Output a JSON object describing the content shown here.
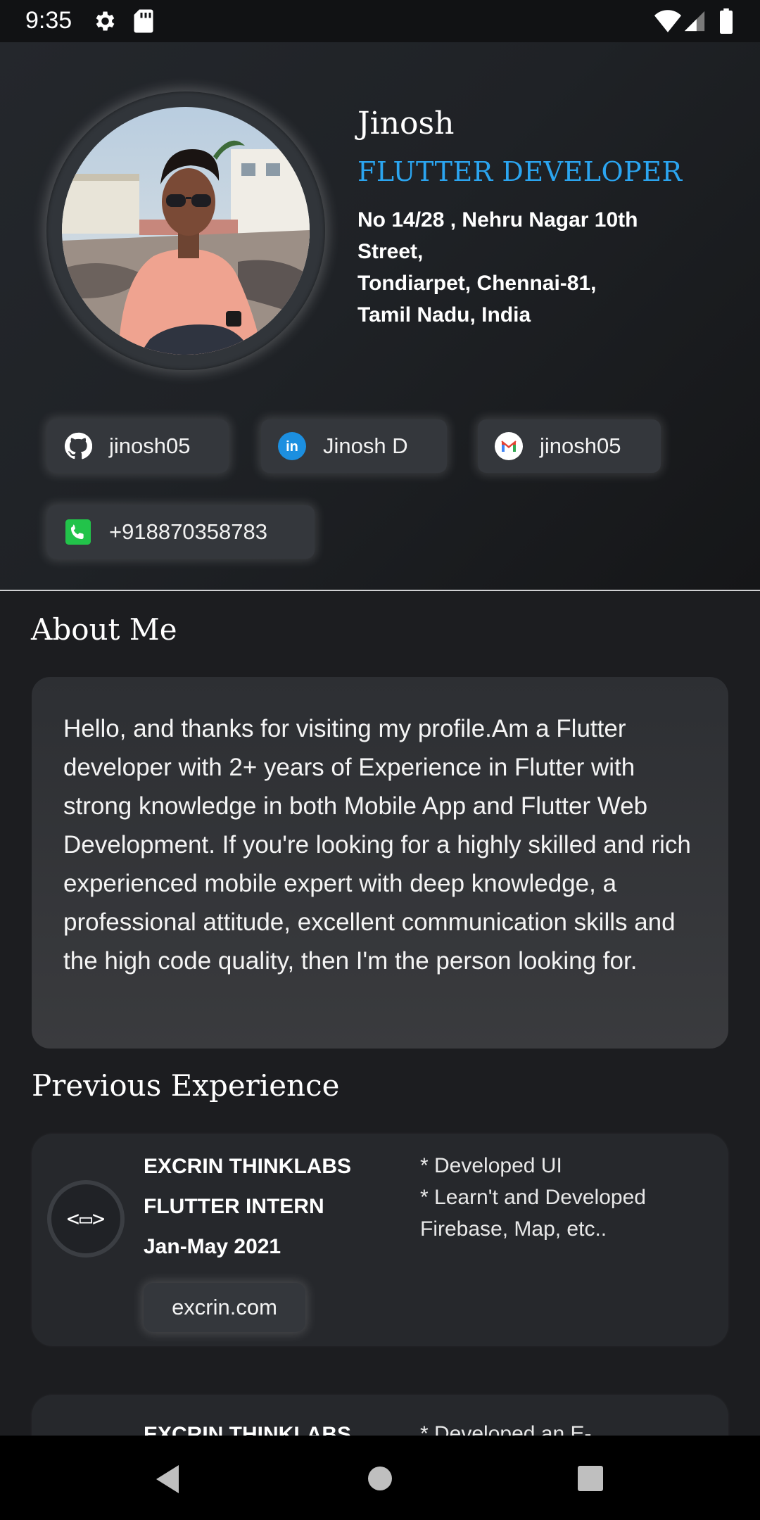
{
  "status_bar": {
    "time": "9:35"
  },
  "profile": {
    "name": "Jinosh",
    "role": "FLUTTER DEVELOPER",
    "address_lines": [
      "No 14/28 , Nehru Nagar 10th",
      "Street,",
      "Tondiarpet, Chennai-81,",
      "Tamil Nadu, India"
    ]
  },
  "contacts": {
    "github": "jinosh05",
    "linkedin": "Jinosh D",
    "gmail": "jinosh05",
    "phone": "+918870358783"
  },
  "about": {
    "title": "About Me",
    "text": "Hello, and thanks for visiting my profile.Am a Flutter developer with 2+ years of Experience in Flutter with strong knowledge in both Mobile App and Flutter Web Development. If you're looking for a highly skilled and rich experienced mobile expert with deep knowledge, a professional attitude, excellent communication skills and the high code quality, then I'm the person looking for."
  },
  "experience": {
    "title": "Previous Experience",
    "items": [
      {
        "company": "EXCRIN THINKLABS",
        "position": "FLUTTER INTERN",
        "period": "Jan-May 2021",
        "logo": "<▭>",
        "description": [
          "* Developed UI",
          "* Learn't and Developed",
          "Firebase, Map, etc.."
        ],
        "link": "excrin.com"
      },
      {
        "company": "EXCRIN THINKLABS",
        "description": [
          "* Developed an E-"
        ]
      }
    ]
  },
  "colors": {
    "accent": "#2ba5f0",
    "background": "#1c1d20",
    "card": "#26282c",
    "chip": "#34373c"
  }
}
